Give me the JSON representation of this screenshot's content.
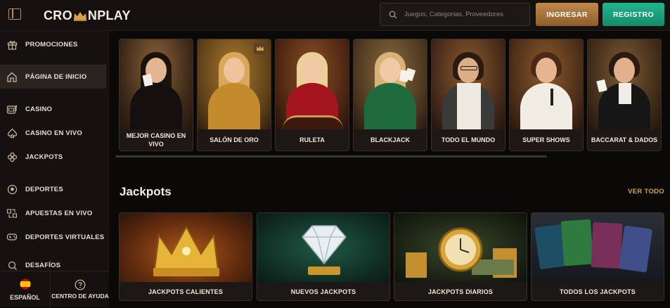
{
  "header": {
    "logo_text_left": "CRO",
    "logo_text_right": "NPLAY",
    "search_placeholder": "Juegos, Categorias, Proveedores",
    "login_label": "INGRESAR",
    "register_label": "REGISTRO"
  },
  "sidebar": {
    "items": [
      {
        "label": "PROMOCIONES",
        "icon": "gift-icon"
      },
      {
        "label": "PÁGINA DE INICIO",
        "icon": "home-icon",
        "active": true
      },
      {
        "label": "CASINO",
        "icon": "slot-machine-icon"
      },
      {
        "label": "CASINO EN VIVO",
        "icon": "spade-icon"
      },
      {
        "label": "JACKPOTS",
        "icon": "clover-icon"
      },
      {
        "label": "DEPORTES",
        "icon": "soccer-ball-icon"
      },
      {
        "label": "APUESTAS EN VIVO",
        "icon": "players-icon"
      },
      {
        "label": "DEPORTES VIRTUALES",
        "icon": "gamepad-icon"
      },
      {
        "label": "DESAFÍOS",
        "icon": "challenge-icon"
      }
    ],
    "language_label": "ESPAÑOL",
    "help_label": "CENTRO DE AYUDA"
  },
  "categories": [
    {
      "label": "MEJOR CASINO EN VIVO"
    },
    {
      "label": "SALÓN DE ORO"
    },
    {
      "label": "RULETA"
    },
    {
      "label": "BLACKJACK"
    },
    {
      "label": "TODO EL MUNDO"
    },
    {
      "label": "SUPER SHOWS"
    },
    {
      "label": "BACCARAT & DADOS"
    }
  ],
  "jackpots": {
    "title": "Jackpots",
    "see_all": "VER TODO",
    "cards": [
      {
        "label": "JACKPOTS CALIENTES"
      },
      {
        "label": "NUEVOS JACKPOTS"
      },
      {
        "label": "JACKPOTS DIARIOS"
      },
      {
        "label": "TODOS LOS JACKPOTS"
      }
    ]
  },
  "colors": {
    "accent_gold": "#d8a24a",
    "login_button": "#a8723c",
    "register_button": "#1ea07e",
    "background": "#0b0908"
  }
}
